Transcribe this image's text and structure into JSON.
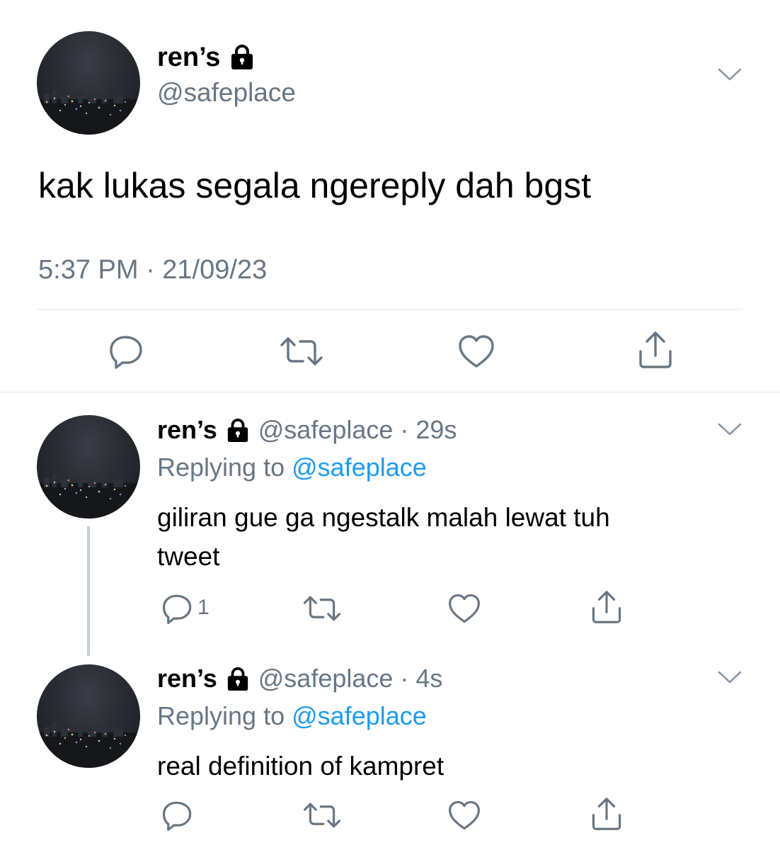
{
  "main_tweet": {
    "display_name": "ren’s",
    "handle": "@safeplace",
    "text": "kak lukas segala ngereply dah bgst",
    "timestamp": "5:37 PM · 21/09/23",
    "icons": [
      "avatar",
      "lock-icon",
      "chevron-down-icon",
      "reply-icon",
      "retweet-icon",
      "like-icon",
      "share-icon"
    ]
  },
  "replies": [
    {
      "display_name": "ren’s",
      "handle": "@safeplace",
      "time": "· 29s",
      "replying_label": "Replying to",
      "replying_to": "@safeplace",
      "text_line1": "giliran gue ga ngestalk malah lewat tuh",
      "text_line2": "tweet",
      "reply_count": "1"
    },
    {
      "display_name": "ren’s",
      "handle": "@safeplace",
      "time": "· 4s",
      "replying_label": "Replying to",
      "replying_to": "@safeplace",
      "text_line1": "real definition of kampret",
      "reply_count": ""
    }
  ],
  "colors": {
    "text": "#000000",
    "secondary": "#687684",
    "link": "#1d9bf0",
    "divider": "#e1e6ea",
    "thread_line": "#c7cfd6"
  }
}
